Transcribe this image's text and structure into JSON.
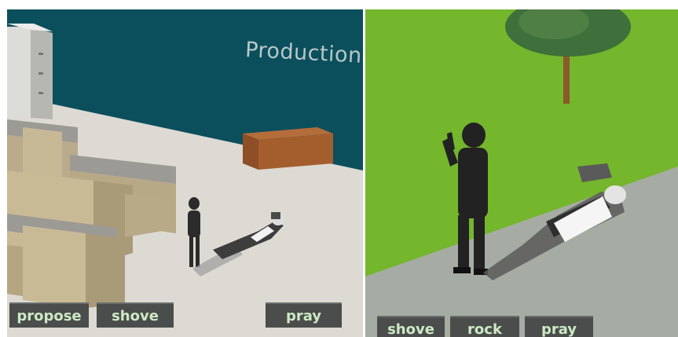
{
  "scene_left": {
    "wall_sign": "Production",
    "actions": [
      {
        "label": "propose"
      },
      {
        "label": "shove"
      },
      {
        "label": "pray"
      }
    ]
  },
  "scene_right": {
    "actions": [
      {
        "label": "shove"
      },
      {
        "label": "rock"
      },
      {
        "label": "pray"
      }
    ]
  },
  "colors": {
    "wall": "#0b4f5c",
    "floor": "#dcdad2",
    "grass": "#74b62c",
    "path": "#a6aca4",
    "button_bg": "#4a4d4c",
    "button_text": "#cde9c4"
  }
}
